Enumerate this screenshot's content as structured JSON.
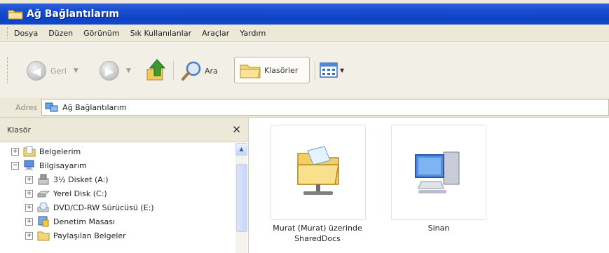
{
  "window": {
    "title": "Ağ Bağlantılarım"
  },
  "menu": {
    "items": [
      "Dosya",
      "Düzen",
      "Görünüm",
      "Sık Kullanılanlar",
      "Araçlar",
      "Yardım"
    ]
  },
  "toolbar": {
    "back_label": "Geri",
    "search_label": "Ara",
    "folders_label": "Klasörler"
  },
  "address": {
    "label": "Adres",
    "value": "Ağ Bağlantılarım"
  },
  "folders_pane": {
    "title": "Klasör",
    "tree": [
      {
        "label": "Belgelerim",
        "icon": "my-documents-icon"
      },
      {
        "label": "Bilgisayarım",
        "icon": "my-computer-icon"
      },
      {
        "label": "3½ Disket (A:)",
        "icon": "floppy-icon"
      },
      {
        "label": "Yerel Disk (C:)",
        "icon": "hard-disk-icon"
      },
      {
        "label": "DVD/CD-RW Sürücüsü (E:)",
        "icon": "dvd-drive-icon"
      },
      {
        "label": "Denetim Masası",
        "icon": "control-panel-icon"
      },
      {
        "label": "Paylaşılan Belgeler",
        "icon": "shared-folder-icon"
      }
    ]
  },
  "content": {
    "items": [
      {
        "label_line1": "Murat (Murat) üzerinde",
        "label_line2": "SharedDocs",
        "icon": "network-share-folder-icon"
      },
      {
        "label_line1": "Sinan",
        "icon": "network-computer-icon"
      }
    ]
  },
  "colors": {
    "titlebar": "#0c42c9",
    "chrome": "#ece9d8",
    "accent_green": "#3e9a2d"
  }
}
